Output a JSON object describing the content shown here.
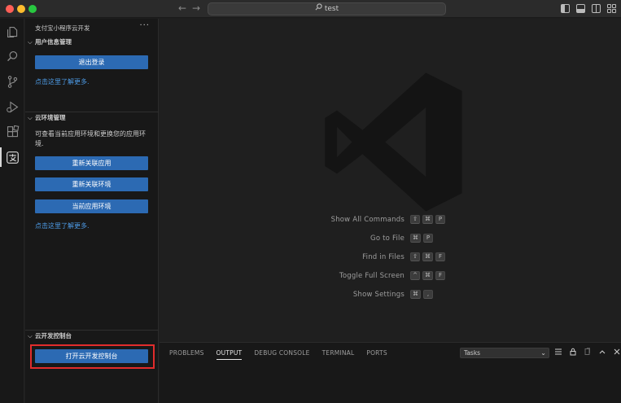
{
  "titlebar": {
    "back_glyph": "←",
    "forward_glyph": "→",
    "search_text": "test",
    "icons": [
      "toggle-primary-sidebar-icon",
      "toggle-panel-icon",
      "toggle-secondary-sidebar-icon",
      "customize-layout-icon"
    ]
  },
  "activity_bar": {
    "items": [
      "explorer-icon",
      "search-icon",
      "source-control-icon",
      "run-debug-icon",
      "extensions-icon",
      "alipay-cloud-icon"
    ]
  },
  "sidebar": {
    "title": "支付宝小程序云开发",
    "more": "···",
    "user_section": {
      "header": "用户信息管理",
      "logout_button": "退出登录",
      "learn_more": "点击这里了解更多."
    },
    "env_section": {
      "header": "云环境管理",
      "description": "可查看当前应用环境和更换您的应用环境.",
      "btn_reassociate_app": "重新关联应用",
      "btn_reassociate_env": "重新关联环境",
      "btn_current_env": "当前应用环境",
      "learn_more": "点击这里了解更多."
    },
    "console_section": {
      "header": "云开发控制台",
      "open_console_button": "打开云开发控制台"
    }
  },
  "editor": {
    "shortcuts": [
      {
        "label": "Show All Commands",
        "keys": [
          "⇧",
          "⌘",
          "P"
        ]
      },
      {
        "label": "Go to File",
        "keys": [
          "⌘",
          "P"
        ]
      },
      {
        "label": "Find in Files",
        "keys": [
          "⇧",
          "⌘",
          "F"
        ]
      },
      {
        "label": "Toggle Full Screen",
        "keys": [
          "^",
          "⌘",
          "F"
        ]
      },
      {
        "label": "Show Settings",
        "keys": [
          "⌘",
          ","
        ]
      }
    ]
  },
  "panel": {
    "tabs": [
      "PROBLEMS",
      "OUTPUT",
      "DEBUG CONSOLE",
      "TERMINAL",
      "PORTS"
    ],
    "active_tab": "OUTPUT",
    "tasks_select": "Tasks",
    "dropdown_glyph": "⌄",
    "tools": [
      "filter-list-icon",
      "lock-icon",
      "clear-output-icon",
      "maximize-panel-icon",
      "close-panel-icon"
    ]
  },
  "colors": {
    "button_blue": "#2c6ab3",
    "link_blue": "#4d9be6",
    "highlight_red": "#e12c2c"
  }
}
